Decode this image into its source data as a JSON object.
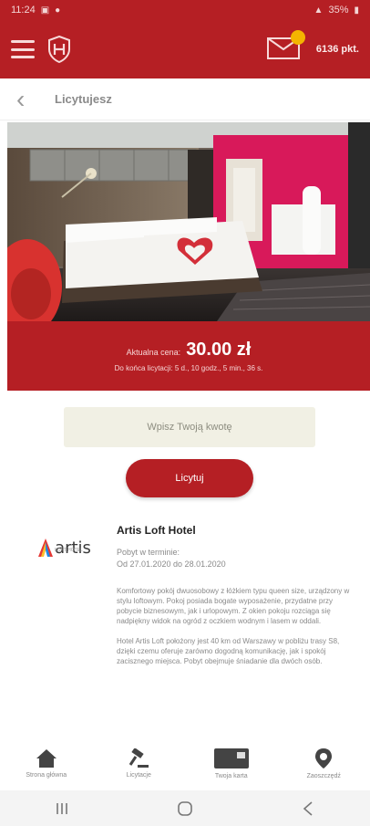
{
  "status_bar": {
    "time": "11:24",
    "right_text": "35%"
  },
  "app_bar": {
    "points": "6136 pkt."
  },
  "header": {
    "title": "Licytujesz"
  },
  "auction": {
    "price_label": "Aktualna cena:",
    "price": "30.00 zł",
    "timer": "Do końca licytacji: 5 d., 10 godz., 5 min., 36 s."
  },
  "bid": {
    "placeholder": "Wpisz Twoją kwotę",
    "button_label": "Licytuj"
  },
  "hotel": {
    "logo_text": "artis",
    "logo_sub": "LOFT HOTEL",
    "name": "Artis Loft Hotel",
    "stay_label": "Pobyt w terminie:",
    "stay_dates": "Od 27.01.2020 do 28.01.2020",
    "description": [
      "Komfortowy pokój dwuosobowy z łóżkiem typu queen size, urządzony w stylu loftowym. Pokoj posiada bogate wyposażenie, przydatne przy pobycie biznesowym, jak i urlopowym. Z okien pokoju rozciąga się nadpiękny widok na ogród z oczkiem wodnym i lasem w oddali.",
      "Hotel Artis Loft położony jest 40 km od Warszawy w pobliżu trasy S8, dzięki czemu oferuje zarówno dogodną komunikację, jak i spokój zacisznego miejsca. Pobyt obejmuje śniadanie dla dwóch osób."
    ]
  },
  "bottom_nav": [
    {
      "label": "Strona główna",
      "icon": "home-icon"
    },
    {
      "label": "Licytacje",
      "icon": "gavel-icon"
    },
    {
      "label": "Twoja karta",
      "icon": "card-icon"
    },
    {
      "label": "Zaoszczędź",
      "icon": "location-pin-icon"
    }
  ],
  "colors": {
    "brand": "#b51f24",
    "input_bg": "#f1f0e4",
    "badge": "#f4b400"
  }
}
